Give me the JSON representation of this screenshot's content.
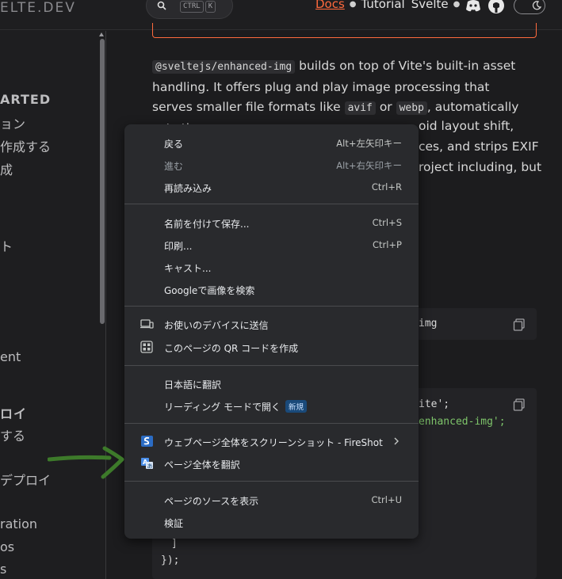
{
  "header": {
    "logo_text": "ELTE.DEV",
    "search_shortcut": [
      "CTRL",
      "K"
    ],
    "nav": [
      "Docs",
      "Tutorial",
      "Svelte"
    ],
    "icons": [
      "search-icon",
      "discord-icon",
      "github-icon",
      "moon-icon"
    ],
    "accent_color": "#ff6a3d"
  },
  "sidebar": {
    "items": [
      {
        "text": "ARTED"
      },
      {
        "text": "ョン"
      },
      {
        "text": "作成する"
      },
      {
        "text": "成"
      },
      {
        "text": "ト"
      },
      {
        "text": "ent"
      },
      {
        "text": "ロイ"
      },
      {
        "text": "する"
      },
      {
        "text": "デプロイ"
      },
      {
        "text": "ration"
      },
      {
        "text": "os"
      },
      {
        "text": "s"
      }
    ]
  },
  "content": {
    "para_parts": {
      "code1": "@sveltejs/enhanced-img",
      "t1": " builds on top of Vite's built-in asset handling. It offers plug and play image processing that serves smaller file formats like ",
      "code2": "avif",
      "t2": " or ",
      "code3": "webp",
      "t3": ", automatically sets the"
    },
    "behind_menu_line1": "oid layout shift,",
    "behind_menu_line2": "ces, and strips EXIF",
    "behind_menu_line3": "roject including, but",
    "codeblock1_text": "img",
    "codeblock2_line1": "ite';",
    "codeblock2_line2": "enhanced-img';",
    "codeblock2_close1": "]",
    "codeblock2_close2": "});",
    "code_string_color": "#7ec46a"
  },
  "context_menu": {
    "groups": [
      [
        {
          "label": "戻る",
          "shortcut": "Alt+左矢印キー"
        },
        {
          "label": "進む",
          "shortcut": "Alt+右矢印キー",
          "disabled": true
        },
        {
          "label": "再読み込み",
          "shortcut": "Ctrl+R"
        }
      ],
      [
        {
          "label": "名前を付けて保存...",
          "shortcut": "Ctrl+S"
        },
        {
          "label": "印刷...",
          "shortcut": "Ctrl+P"
        },
        {
          "label": "キャスト..."
        },
        {
          "label": "Googleで画像を検索"
        }
      ],
      [
        {
          "label": "お使いのデバイスに送信",
          "icon": "devices-icon"
        },
        {
          "label": "このページの QR コードを作成",
          "icon": "qr-code-icon"
        }
      ],
      [
        {
          "label": "日本語に翻訳"
        },
        {
          "label": "リーディング モードで開く",
          "badge": "新規"
        }
      ],
      [
        {
          "label": "ウェブページ全体をスクリーンショット - FireShot",
          "icon": "fireshot-icon",
          "submenu": true
        },
        {
          "label": "ページ全体を翻訳",
          "icon": "translate-icon"
        }
      ],
      [
        {
          "label": "ページのソースを表示",
          "shortcut": "Ctrl+U"
        },
        {
          "label": "検証"
        }
      ]
    ]
  },
  "annotation": {
    "arrow_color": "#3d7a2a"
  }
}
